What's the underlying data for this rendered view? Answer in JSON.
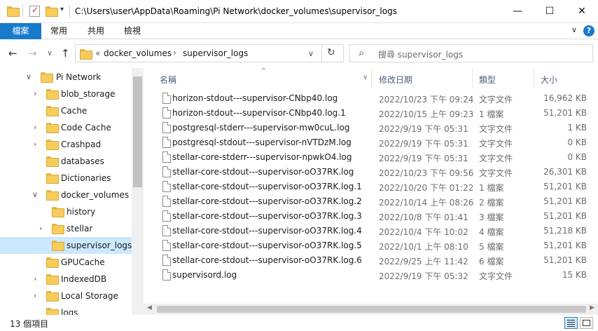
{
  "window": {
    "title_path": "C:\\Users\\user\\AppData\\Roaming\\Pi Network\\docker_volumes\\supervisor_logs",
    "minimize_icon": "—",
    "maximize_icon": "☐",
    "close_icon": "✕"
  },
  "ribbon": {
    "tabs": [
      {
        "label": "檔案"
      },
      {
        "label": "常用"
      },
      {
        "label": "共用"
      },
      {
        "label": "檢視"
      }
    ],
    "collapse_icon": "∨",
    "help_icon": "?"
  },
  "nav": {
    "back_icon": "←",
    "forward_icon": "→",
    "recent_icon": "∨",
    "up_icon": "↑",
    "breadcrumb_overflow": "«",
    "breadcrumb": [
      "docker_volumes",
      "supervisor_logs"
    ],
    "separator": "›",
    "dropdown_icon": "∨",
    "refresh_icon": "↻",
    "search_placeholder": "搜尋 supervisor_logs",
    "search_icon": "⌕"
  },
  "tree": [
    {
      "label": "Pi Network",
      "expanded": true
    },
    {
      "label": "blob_storage",
      "expandable": true
    },
    {
      "label": "Cache",
      "expandable": false
    },
    {
      "label": "Code Cache",
      "expandable": true
    },
    {
      "label": "Crashpad",
      "expandable": true
    },
    {
      "label": "databases",
      "expandable": false
    },
    {
      "label": "Dictionaries",
      "expandable": false
    },
    {
      "label": "docker_volumes",
      "expanded": true
    },
    {
      "label": "history",
      "expandable": false
    },
    {
      "label": "stellar",
      "expandable": true
    },
    {
      "label": "supervisor_logs",
      "selected": true
    },
    {
      "label": "GPUCache",
      "expandable": false
    },
    {
      "label": "IndexedDB",
      "expandable": true
    },
    {
      "label": "Local Storage",
      "expandable": true
    },
    {
      "label": "logs",
      "expandable": false
    }
  ],
  "columns": {
    "name": "名稱",
    "date": "修改日期",
    "type": "類型",
    "size": "大小",
    "sort_icon": "^",
    "dropdown_icon": "∨"
  },
  "files": [
    {
      "name": "horizon-stdout---supervisor-CNbp40.log",
      "date": "2022/10/23 下午 09:24",
      "type": "文字文件",
      "size": "16,962 KB"
    },
    {
      "name": "horizon-stdout---supervisor-CNbp40.log.1",
      "date": "2022/10/15 上午 09:23",
      "type": "1 檔案",
      "size": "51,201 KB"
    },
    {
      "name": "postgresql-stderr---supervisor-mw0cuL.log",
      "date": "2022/9/19 下午 05:31",
      "type": "文字文件",
      "size": "1 KB"
    },
    {
      "name": "postgresql-stdout---supervisor-nVTDzM.log",
      "date": "2022/9/19 下午 05:31",
      "type": "文字文件",
      "size": "0 KB"
    },
    {
      "name": "stellar-core-stderr---supervisor-npwkO4.log",
      "date": "2022/9/19 下午 05:31",
      "type": "文字文件",
      "size": "0 KB"
    },
    {
      "name": "stellar-core-stdout---supervisor-oO37RK.log",
      "date": "2022/10/23 下午 09:56",
      "type": "文字文件",
      "size": "26,301 KB"
    },
    {
      "name": "stellar-core-stdout---supervisor-oO37RK.log.1",
      "date": "2022/10/20 下午 01:22",
      "type": "1 檔案",
      "size": "51,201 KB"
    },
    {
      "name": "stellar-core-stdout---supervisor-oO37RK.log.2",
      "date": "2022/10/14 上午 08:26",
      "type": "2 檔案",
      "size": "51,201 KB"
    },
    {
      "name": "stellar-core-stdout---supervisor-oO37RK.log.3",
      "date": "2022/10/8 下午 01:41",
      "type": "3 檔案",
      "size": "51,201 KB"
    },
    {
      "name": "stellar-core-stdout---supervisor-oO37RK.log.4",
      "date": "2022/10/4 下午 10:02",
      "type": "4 檔案",
      "size": "51,218 KB"
    },
    {
      "name": "stellar-core-stdout---supervisor-oO37RK.log.5",
      "date": "2022/10/1 上午 08:10",
      "type": "5 檔案",
      "size": "51,201 KB"
    },
    {
      "name": "stellar-core-stdout---supervisor-oO37RK.log.6",
      "date": "2022/9/25 上午 11:42",
      "type": "6 檔案",
      "size": "51,201 KB"
    },
    {
      "name": "supervisord.log",
      "date": "2022/9/19 下午 05:32",
      "type": "文字文件",
      "size": "15 KB"
    }
  ],
  "status": {
    "item_count": "13 個項目"
  }
}
